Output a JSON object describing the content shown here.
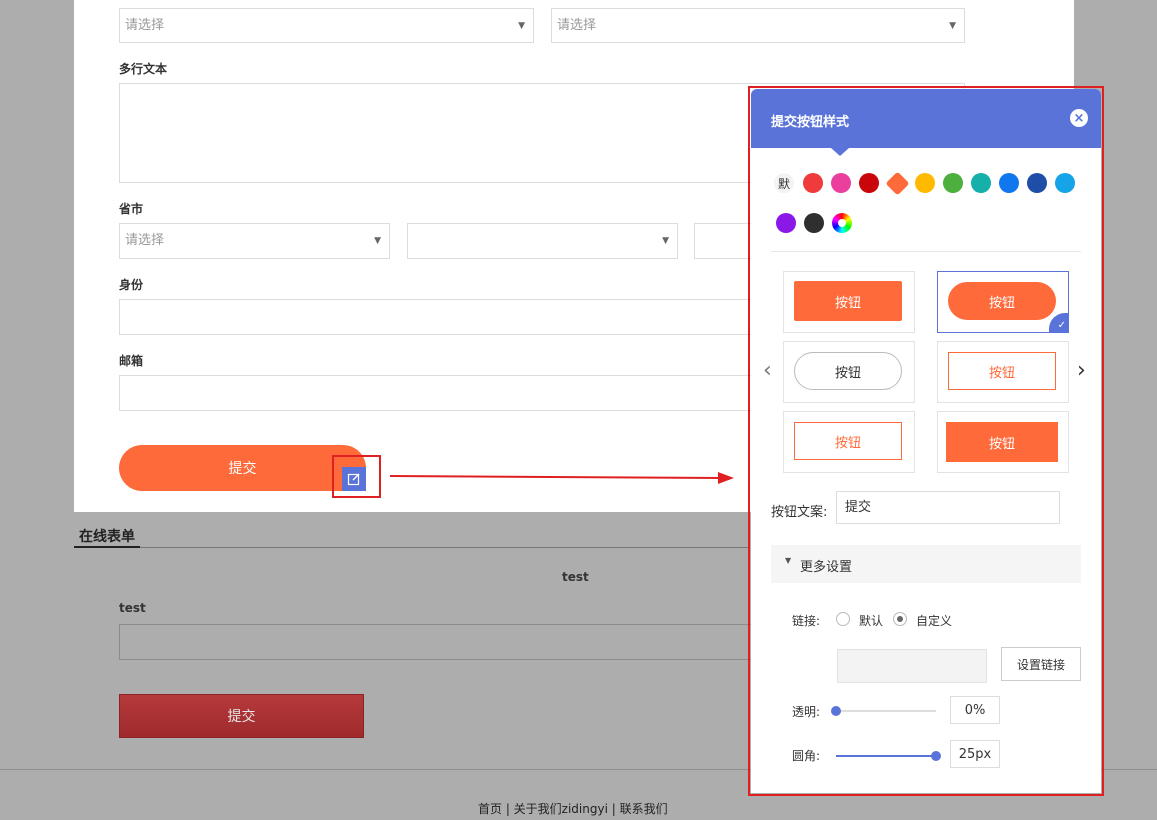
{
  "form": {
    "select_placeholder": "请选择",
    "multiline_label": "多行文本",
    "province_label": "省市",
    "identity_label": "身份",
    "email_label": "邮箱",
    "submit_label": "提交"
  },
  "section": {
    "tab_title": "在线表单",
    "form_title": "test",
    "field_label": "test",
    "submit_label": "提交"
  },
  "footer": {
    "links": "首页 | 关于我们zidingyi | 联系我们"
  },
  "panel": {
    "title": "提交按钮样式",
    "default_swatch": "默",
    "colors": [
      "#ef3b3b",
      "#ea3f9d",
      "#c9070b",
      "#ff6a3a",
      "#ffba00",
      "#4caf3e",
      "#14b0a9",
      "#1177ee",
      "#1e4ea8",
      "#16a4e8",
      "#8a19e8",
      "#2f2f2f"
    ],
    "selected_color": "#ff6a3a",
    "button_sample": "按钮",
    "button_text_label": "按钮文案:",
    "button_text_value": "提交",
    "more_settings": "更多设置",
    "link_label": "链接:",
    "link_default": "默认",
    "link_custom": "自定义",
    "set_link_button": "设置链接",
    "opacity_label": "透明:",
    "opacity_value": "0%",
    "opacity_fraction": 0,
    "radius_label": "圆角:",
    "radius_value": "25px",
    "radius_fraction": 1,
    "accent": "#5a73d8",
    "brand": "#ff6a3a"
  }
}
